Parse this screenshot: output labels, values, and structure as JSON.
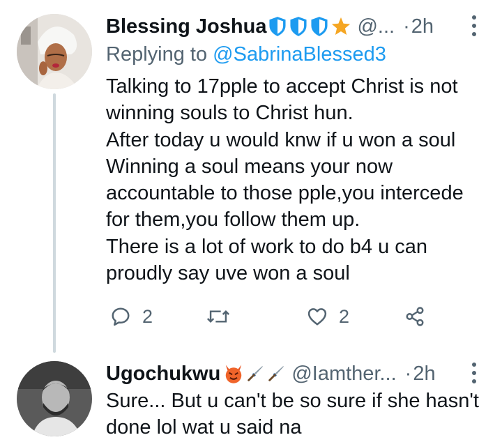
{
  "tweets": [
    {
      "author": "Blessing Joshua",
      "handle": "@...",
      "separator": "·",
      "time": "2h",
      "replying_prefix": "Replying to",
      "replying_to": "@SabrinaBlessed3",
      "lines": [
        "Talking to 17pple to accept Christ is not",
        "winning souls to Christ hun.",
        "After today u would knw if u won a soul",
        "Winning a soul means your now",
        "accountable to those pple,you intercede",
        "for them,you follow them up.",
        "There is a lot of work to do b4 u can",
        "proudly say uve won a soul"
      ],
      "badges": [
        "shield-icon",
        "shield-icon",
        "shield-icon",
        "star-icon"
      ],
      "actions": {
        "reply_count": "2",
        "retweet_count": "",
        "like_count": "2"
      }
    },
    {
      "author": "Ugochukwu",
      "handle": "@Iamther...",
      "separator": "·",
      "time": "2h",
      "lines": [
        "Sure... But u can't be so sure if she hasn't",
        "done lol wat u said na"
      ],
      "badges": [
        "devil-emoji-icon",
        "dagger-icon",
        "dagger-icon"
      ]
    }
  ],
  "colors": {
    "text": "#0f1419",
    "secondary": "#536471",
    "link": "#1d9bf0",
    "thread_line": "#cfd9de",
    "badge_blue": "#1d9bf0",
    "star": "#f5a623"
  }
}
